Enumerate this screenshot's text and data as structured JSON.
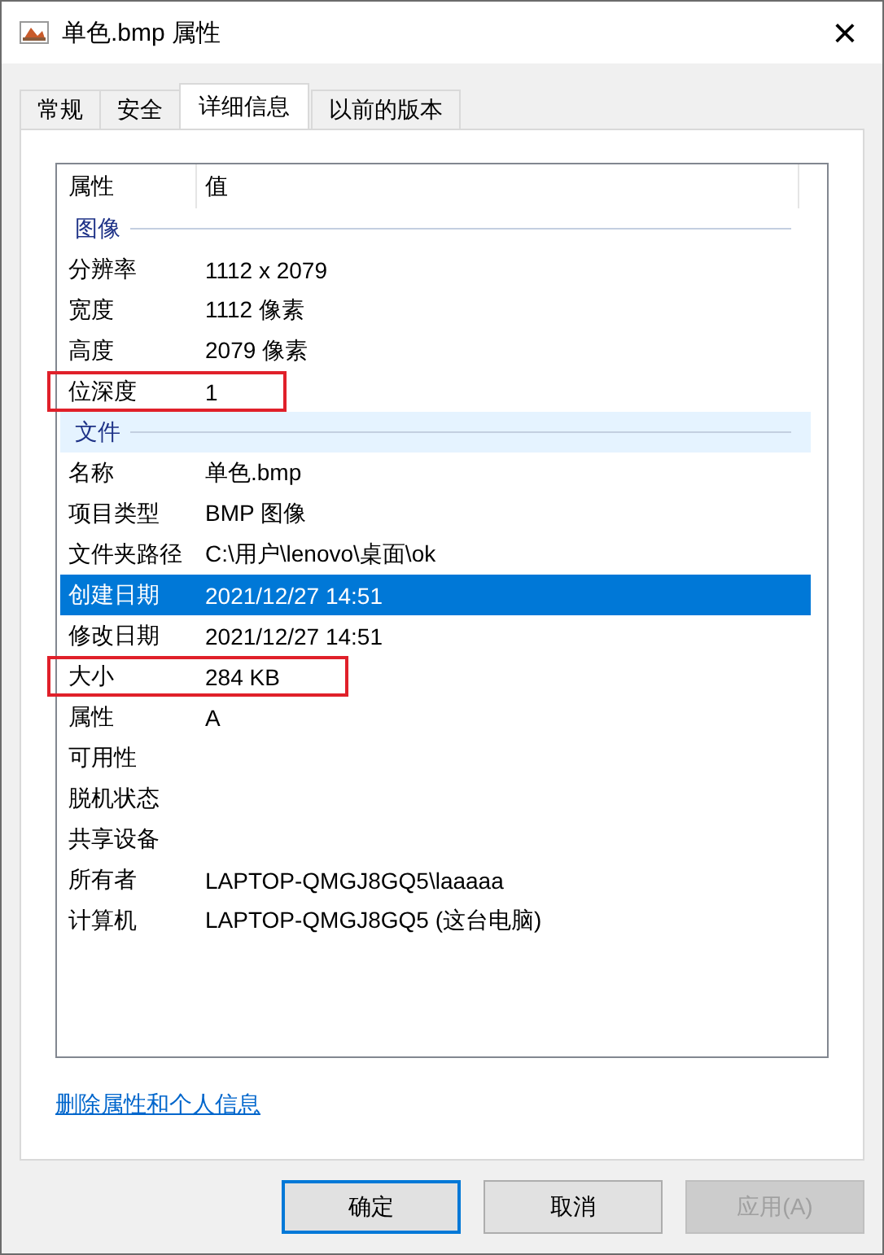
{
  "window": {
    "title": "单色.bmp 属性",
    "close": "×"
  },
  "tabs": [
    {
      "label": "常规",
      "selected": false
    },
    {
      "label": "安全",
      "selected": false
    },
    {
      "label": "详细信息",
      "selected": true
    },
    {
      "label": "以前的版本",
      "selected": false
    }
  ],
  "table": {
    "columns": [
      "属性",
      "值"
    ],
    "rows": [
      {
        "kind": "group",
        "label": "图像",
        "hovered": false
      },
      {
        "kind": "item",
        "label": "分辨率",
        "value": "1112 x 2079",
        "selected": false,
        "annotated": false
      },
      {
        "kind": "item",
        "label": "宽度",
        "value": "1112 像素",
        "selected": false,
        "annotated": false
      },
      {
        "kind": "item",
        "label": "高度",
        "value": "2079 像素",
        "selected": false,
        "annotated": false
      },
      {
        "kind": "item",
        "label": "位深度",
        "value": "1",
        "selected": false,
        "annotated": true
      },
      {
        "kind": "group",
        "label": "文件",
        "hovered": true
      },
      {
        "kind": "item",
        "label": "名称",
        "value": "单色.bmp",
        "selected": false,
        "annotated": false
      },
      {
        "kind": "item",
        "label": "项目类型",
        "value": "BMP 图像",
        "selected": false,
        "annotated": false
      },
      {
        "kind": "item",
        "label": "文件夹路径",
        "value": "C:\\用户\\lenovo\\桌面\\ok",
        "selected": false,
        "annotated": false
      },
      {
        "kind": "item",
        "label": "创建日期",
        "value": "2021/12/27 14:51",
        "selected": true,
        "annotated": false
      },
      {
        "kind": "item",
        "label": "修改日期",
        "value": "2021/12/27 14:51",
        "selected": false,
        "annotated": false
      },
      {
        "kind": "item",
        "label": "大小",
        "value": "284 KB",
        "selected": false,
        "annotated": true
      },
      {
        "kind": "item",
        "label": "属性",
        "value": "A",
        "selected": false,
        "annotated": false
      },
      {
        "kind": "item",
        "label": "可用性",
        "selected": false,
        "annotated": false
      },
      {
        "kind": "item",
        "label": "脱机状态",
        "selected": false,
        "annotated": false
      },
      {
        "kind": "item",
        "label": "共享设备",
        "selected": false,
        "annotated": false
      },
      {
        "kind": "item",
        "label": "所有者",
        "value": "LAPTOP-QMGJ8GQ5\\laaaaa",
        "selected": false,
        "annotated": false
      },
      {
        "kind": "item",
        "label": "计算机",
        "value": "LAPTOP-QMGJ8GQ5 (这台电脑)",
        "selected": false,
        "annotated": false
      }
    ]
  },
  "link": "删除属性和个人信息",
  "buttons": [
    {
      "label": "确定",
      "default": true,
      "disabled": false
    },
    {
      "label": "取消",
      "default": false,
      "disabled": false
    },
    {
      "label": "应用(A)",
      "default": false,
      "disabled": true
    }
  ]
}
